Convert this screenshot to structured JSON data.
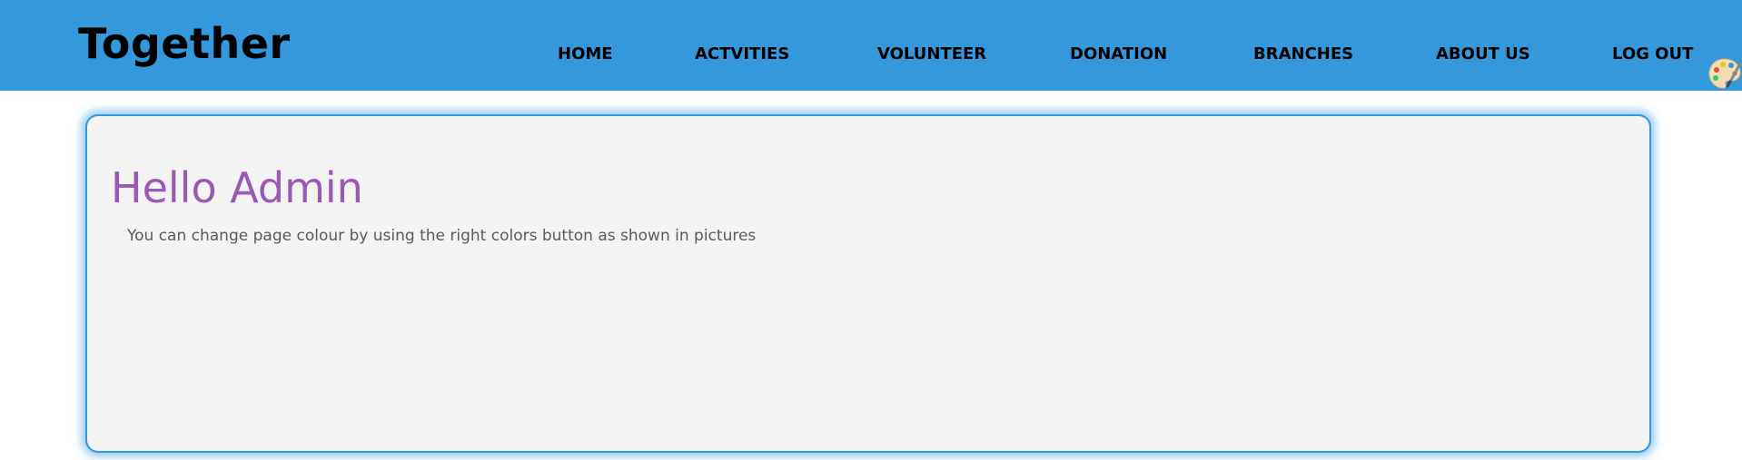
{
  "header": {
    "brand": "Together",
    "background_color": "#3498db",
    "nav": [
      {
        "label": "HOME"
      },
      {
        "label": "ACTVITIES"
      },
      {
        "label": "VOLUNTEER"
      },
      {
        "label": "DONATION"
      },
      {
        "label": "BRANCHES"
      },
      {
        "label": "ABOUT US"
      },
      {
        "label": "LOG OUT"
      }
    ],
    "theme_button_icon": "palette-icon"
  },
  "main": {
    "greeting": "Hello Admin",
    "greeting_color": "#9b59b6",
    "message": "You can change page colour by using the right colors button as shown in pictures",
    "card_background": "#f3f3f3",
    "card_border_color": "#3498db"
  }
}
